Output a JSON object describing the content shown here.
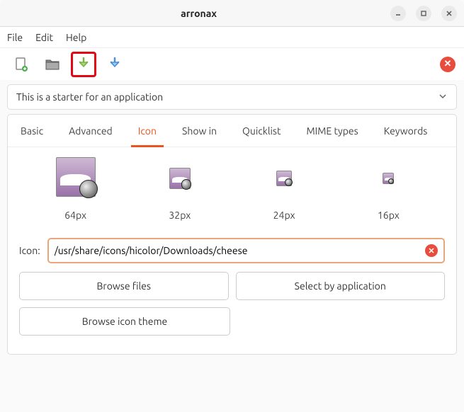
{
  "window": {
    "title": "arronax"
  },
  "menu": {
    "file": "File",
    "edit": "Edit",
    "help": "Help"
  },
  "description": {
    "text": "This is a starter for an application"
  },
  "tabs": {
    "basic": "Basic",
    "advanced": "Advanced",
    "icon": "Icon",
    "showin": "Show in",
    "quicklist": "Quicklist",
    "mime": "MIME types",
    "keywords": "Keywords"
  },
  "icon_sizes": {
    "s64": "64px",
    "s32": "32px",
    "s24": "24px",
    "s16": "16px"
  },
  "icon_field": {
    "label": "Icon:",
    "value": "/usr/share/icons/hicolor/Downloads/cheese"
  },
  "buttons": {
    "browse_files": "Browse files",
    "select_by_app": "Select by application",
    "browse_theme": "Browse icon theme"
  }
}
